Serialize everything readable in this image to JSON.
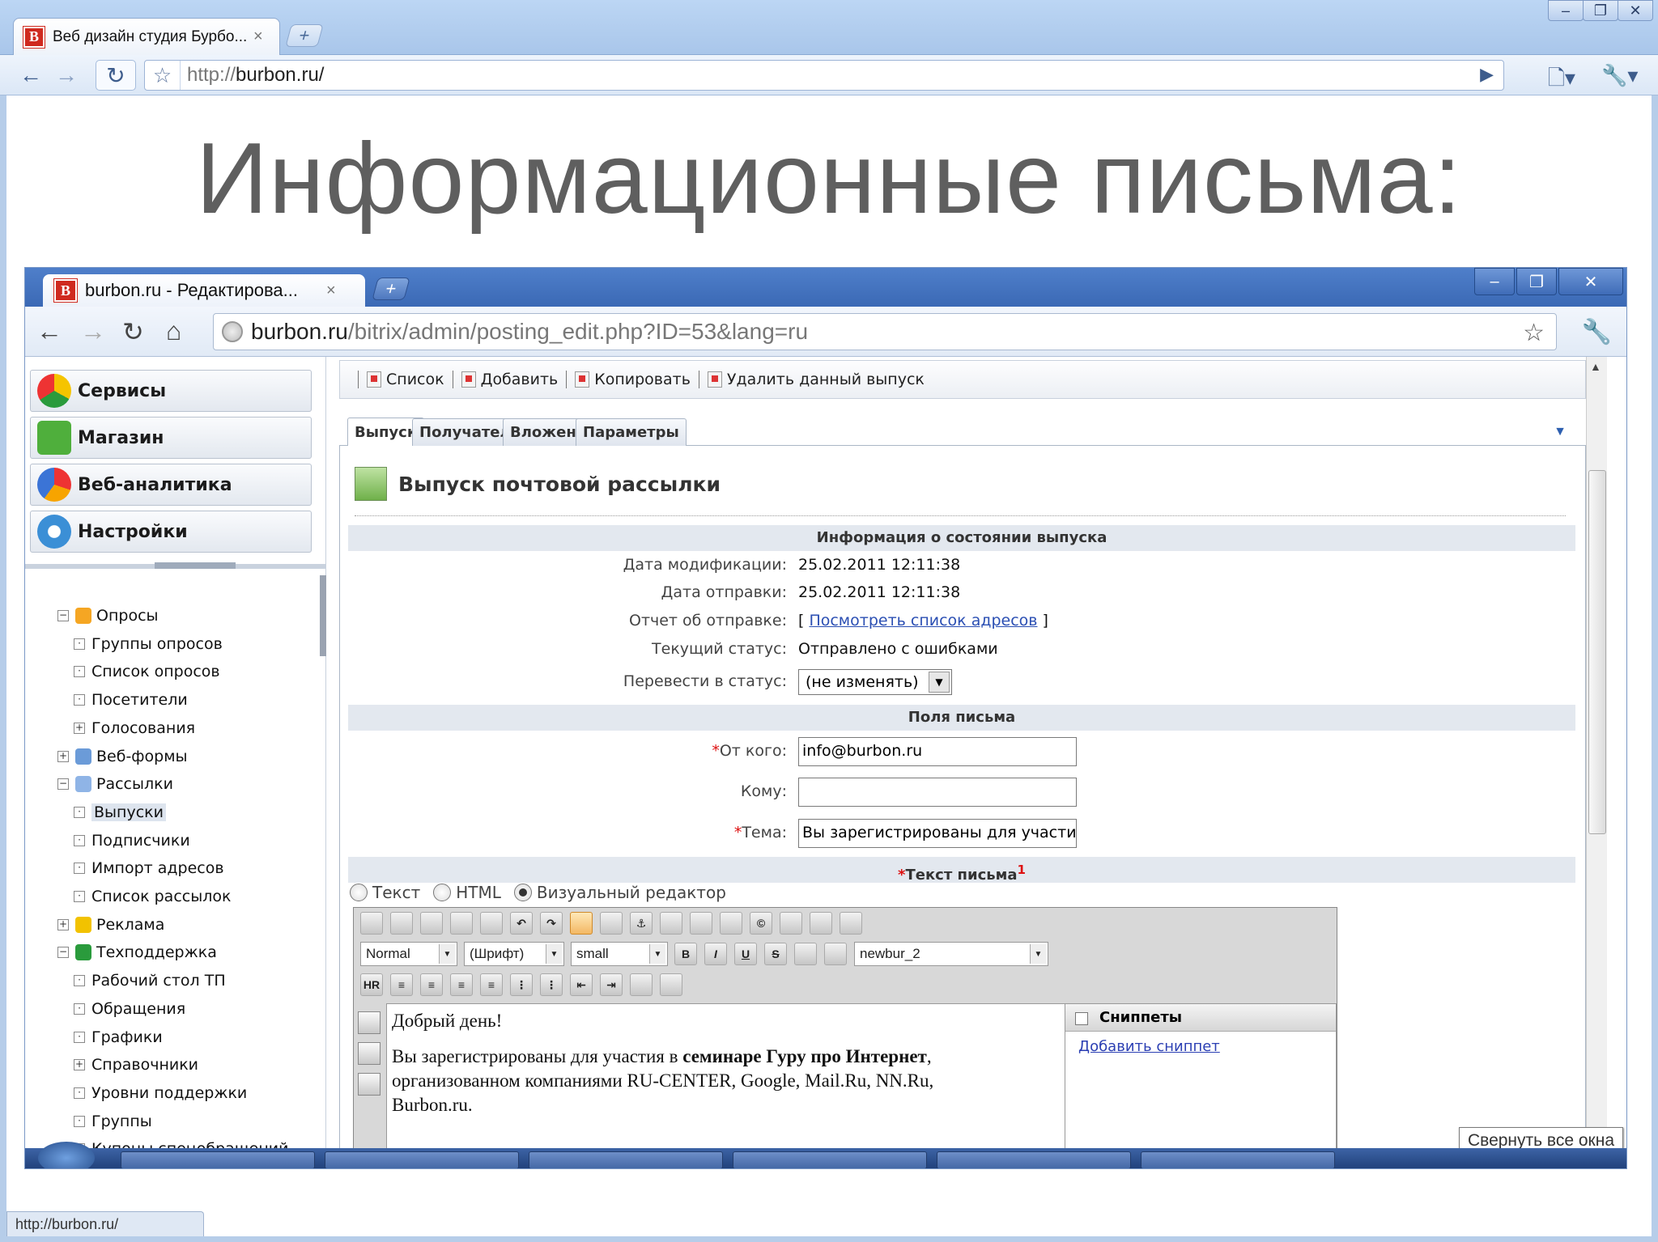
{
  "outer_browser": {
    "tab_title": "Веб дизайн студия Бурбо...",
    "favicon_letter": "B",
    "url_scheme": "http://",
    "url_host": "burbon.ru/",
    "status_url": "http://burbon.ru/"
  },
  "slide": {
    "title": "Информационные письма:"
  },
  "inner_browser": {
    "tab_title": "burbon.ru - Редактирова...",
    "favicon_letter": "B",
    "url_host": "burbon.ru",
    "url_path": "/bitrix/admin/posting_edit.php?ID=53&lang=ru"
  },
  "left_menu": {
    "buttons": [
      "Сервисы",
      "Магазин",
      "Веб-аналитика",
      "Настройки"
    ],
    "tree": [
      {
        "label": "Опросы",
        "sign": "−"
      },
      {
        "label": "Группы опросов",
        "sign": "·"
      },
      {
        "label": "Список опросов",
        "sign": "·"
      },
      {
        "label": "Посетители",
        "sign": "·"
      },
      {
        "label": "Голосования",
        "sign": "+"
      },
      {
        "label": "Веб-формы",
        "sign": "+"
      },
      {
        "label": "Рассылки",
        "sign": "−"
      },
      {
        "label": "Выпуски",
        "sign": "·"
      },
      {
        "label": "Подписчики",
        "sign": "·"
      },
      {
        "label": "Импорт адресов",
        "sign": "·"
      },
      {
        "label": "Список рассылок",
        "sign": "·"
      },
      {
        "label": "Реклама",
        "sign": "+"
      },
      {
        "label": "Техподдержка",
        "sign": "−"
      },
      {
        "label": "Рабочий стол ТП",
        "sign": "·"
      },
      {
        "label": "Обращения",
        "sign": "·"
      },
      {
        "label": "Графики",
        "sign": "·"
      },
      {
        "label": "Справочники",
        "sign": "+"
      },
      {
        "label": "Уровни поддержки",
        "sign": "·"
      },
      {
        "label": "Группы",
        "sign": "·"
      },
      {
        "label": "Купоны спецобращений",
        "sign": "·"
      }
    ]
  },
  "toolbar": {
    "list": "Список",
    "add": "Добавить",
    "copy": "Копировать",
    "delete": "Удалить данный выпуск"
  },
  "tabs": [
    "Выпуск",
    "Получатели",
    "Вложения",
    "Параметры"
  ],
  "form": {
    "heading": "Выпуск почтовой рассылки",
    "section_status": "Информация о состоянии выпуска",
    "modified_label": "Дата модификации:",
    "modified_value": "25.02.2011 12:11:38",
    "sent_label": "Дата отправки:",
    "sent_value": "25.02.2011 12:11:38",
    "report_label": "Отчет об отправке:",
    "report_link": "Посмотреть список адресов",
    "status_label": "Текущий статус:",
    "status_value": "Отправлено с ошибками",
    "change_label": "Перевести в статус:",
    "change_value": "(не изменять)",
    "section_fields": "Поля письма",
    "from_label": "От кого:",
    "from_value": "info@burbon.ru",
    "to_label": "Кому:",
    "to_value": "",
    "subject_label": "Тема:",
    "subject_value": "Вы зарегистрированы для участи",
    "section_body": "Текст письма",
    "footnote": "1"
  },
  "editor": {
    "mode_text": "Текст",
    "mode_html": "HTML",
    "mode_visual": "Визуальный редактор",
    "style_select": "Normal",
    "font_select": "(Шрифт)",
    "size_select": "small",
    "template_select": "newbur_2",
    "bold": "B",
    "italic": "I",
    "underline": "U",
    "strike": "S",
    "hr": "HR",
    "line1": "Добрый день!",
    "line2_start": "Вы зарегистрированы для участия в ",
    "line2_bold": "семинаре Гуру про Интернет",
    "line2_end": ",",
    "line3": "организованном компаниями RU-CENTER, Google, Mail.Ru, NN.Ru,",
    "line4": "Burbon.ru.",
    "snippets_title": "Сниппеты",
    "add_snippet": "Добавить сниппет"
  },
  "tooltip": "Свернуть все окна"
}
